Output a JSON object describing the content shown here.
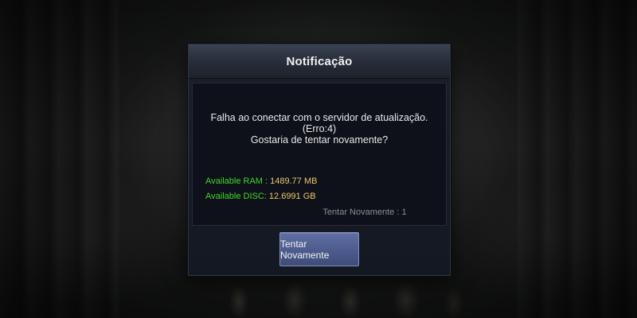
{
  "dialog": {
    "title": "Notificação",
    "message_lines": [
      "Falha ao conectar com o servidor de atualização.",
      "(Erro:4)",
      "Gostaria de tentar novamente?"
    ],
    "ram_label": "Available RAM :",
    "ram_value": "1489.77 MB",
    "disc_label": "Available DISC:",
    "disc_value": "12.6991 GB",
    "retry_count_text": "Tentar Novamente : 1",
    "retry_button_label": "Tentar Novamente"
  },
  "colors": {
    "stat_label": "#43d72c",
    "stat_value": "#e8c96a",
    "button": "#4e5d8f"
  }
}
